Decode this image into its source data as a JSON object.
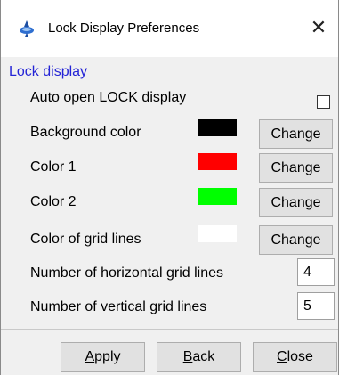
{
  "window": {
    "title": "Lock Display Preferences",
    "app_icon": "topspin-icon",
    "close_glyph": "✕"
  },
  "group": {
    "title": "Lock display"
  },
  "auto_open": {
    "label": "Auto open LOCK display",
    "checked": false
  },
  "colors": [
    {
      "label": "Background color",
      "swatch": "#000000",
      "button": "Change"
    },
    {
      "label": "Color 1",
      "swatch": "#ff0000",
      "button": "Change"
    },
    {
      "label": "Color 2",
      "swatch": "#00ff00",
      "button": "Change"
    },
    {
      "label": "Color of grid lines",
      "swatch": "#ffffff",
      "button": "Change"
    }
  ],
  "grid": {
    "horizontal_label": "Number of horizontal grid lines",
    "horizontal_value": "4",
    "vertical_label": "Number of vertical grid lines",
    "vertical_value": "5"
  },
  "footer": {
    "apply": {
      "mnemonic": "A",
      "rest": "pply"
    },
    "back": {
      "mnemonic": "B",
      "rest": "ack"
    },
    "close": {
      "mnemonic": "C",
      "rest": "lose"
    }
  },
  "accent_color": "#2424d6"
}
